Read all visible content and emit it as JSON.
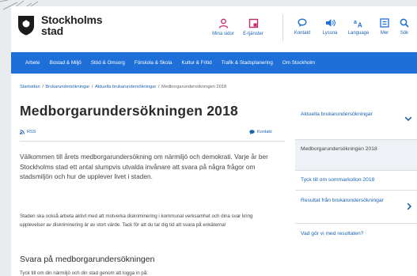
{
  "logo": {
    "line1": "Stockholms",
    "line2": "stad"
  },
  "header": {
    "primary": [
      {
        "label": "Mina sidor",
        "icon": "person-icon"
      },
      {
        "label": "E-tjänster",
        "icon": "e-services-icon"
      }
    ],
    "tools": [
      {
        "label": "Kontakt",
        "icon": "chat-bubble-icon"
      },
      {
        "label": "Lyssna",
        "icon": "speaker-icon"
      },
      {
        "label": "Language",
        "icon": "translate-icon"
      },
      {
        "label": "Mer",
        "icon": "menu-box-icon"
      },
      {
        "label": "Sök",
        "icon": "search-icon"
      }
    ]
  },
  "nav": {
    "items": [
      "Arbete",
      "Bostad & Miljö",
      "Stöd & Omsorg",
      "Förskola & Skola",
      "Kultur & Fritid",
      "Trafik & Stadsplanering",
      "Om Stockholm"
    ]
  },
  "breadcrumb": [
    "Startsidan",
    "Brukarundersökningar",
    "Aktuella brukarundersökningar",
    "Medborgarundersökningen 2018"
  ],
  "main": {
    "title": "Medborgarundersökningen 2018",
    "rss": "RSS",
    "kontakt": "Kontakt",
    "intro": "Välkommen till årets medborgarundersökning om närmiljö och demokrati. Varje år ber Stockholms stad ett antal slumpvis utvalda invånare att svara på några frågor om stadsmiljön och hur de upplever livet i staden.",
    "body": "Staden ska också arbeta aktivt med att motverka diskriminering i kommunal verksamhet och dina svar kring upplevelser av diskriminering är av stort värde. Tack för att du tar dig tid att svara på enkäterna!",
    "subheading": "Svara på medborgarundersökningen",
    "subtext": "Tyck till om din närmiljö och din stad genom att logga in på:"
  },
  "sidebar": {
    "items": [
      {
        "label": "Aktuella brukarundersökningar"
      },
      {
        "label": "Medborgarundersökningen 2018"
      },
      {
        "label": "Tyck till om sommarkollon 2018"
      },
      {
        "label": "Resultat från brukarundersökningar"
      },
      {
        "label": "Vad gör vi med resultaten?"
      }
    ]
  },
  "colors": {
    "brand_blue": "#1e70d8",
    "link_blue": "#1963b3",
    "accent_pink": "#c8286b",
    "active_bg": "#eef2f7"
  }
}
